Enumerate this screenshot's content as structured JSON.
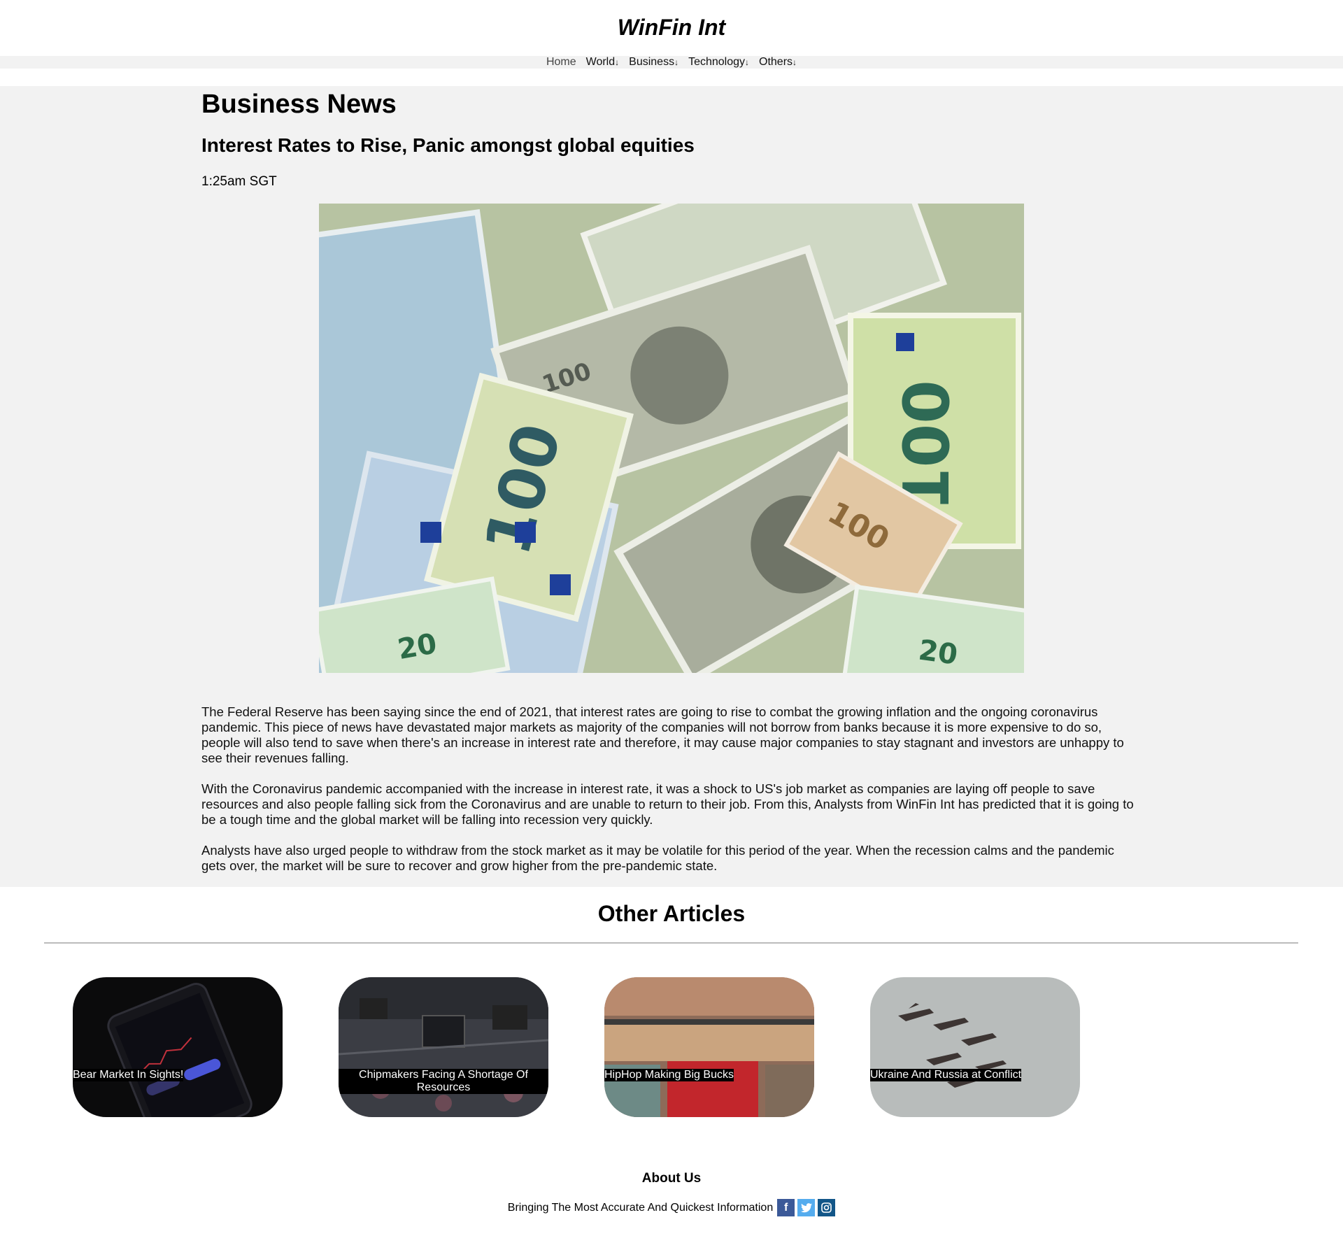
{
  "site": {
    "brand": "WinFin Int"
  },
  "nav": {
    "items": [
      {
        "label": "Home"
      },
      {
        "label": "World",
        "arrow": "↓"
      },
      {
        "label": "Business",
        "arrow": "↓"
      },
      {
        "label": "Technology",
        "arrow": "↓"
      },
      {
        "label": "Others",
        "arrow": "↓"
      }
    ]
  },
  "article": {
    "section": "Business News",
    "title": "Interest Rates to Rise, Panic amongst global equities",
    "time": "1:25am SGT",
    "paragraphs": [
      "The Federal Reserve has been saying since the end of 2021, that interest rates are going to rise to combat the growing inflation and the ongoing coronavirus pandemic. This piece of news have devastated major markets as majority of the companies will not borrow from banks because it is more expensive to do so, people will also tend to save when there's an increase in interest rate and therefore, it may cause major companies to stay stagnant and investors are unhappy to see their revenues falling.",
      "With the Coronavirus pandemic accompanied with the increase in interest rate, it was a shock to US's job market as companies are laying off people to save resources and also people falling sick from the Coronavirus and are unable to return to their job. From this, Analysts from WinFin Int has predicted that it is going to be a tough time and the global market will be falling into recession very quickly.",
      "Analysts have also urged people to withdraw from the stock market as it may be volatile for this period of the year. When the recession calms and the pandemic gets over, the market will be sure to recover and grow higher from the pre-pandemic state."
    ]
  },
  "other_articles": {
    "title": "Other Articles",
    "cards": [
      {
        "caption": "Bear Market In Sights!"
      },
      {
        "caption": "Chipmakers Facing A Shortage Of Resources"
      },
      {
        "caption": "HipHop Making Big Bucks"
      },
      {
        "caption": "Ukraine And Russia at Conflict"
      }
    ]
  },
  "footer": {
    "about_title": "About Us",
    "tagline": "Bringing The Most Accurate And Quickest Information",
    "social": [
      {
        "icon": "facebook-icon",
        "glyph": "f",
        "color": "#3b5998"
      },
      {
        "icon": "twitter-icon",
        "glyph": "t",
        "color": "#55acee"
      },
      {
        "icon": "instagram-icon",
        "glyph": "◎",
        "color": "#125688"
      }
    ]
  }
}
